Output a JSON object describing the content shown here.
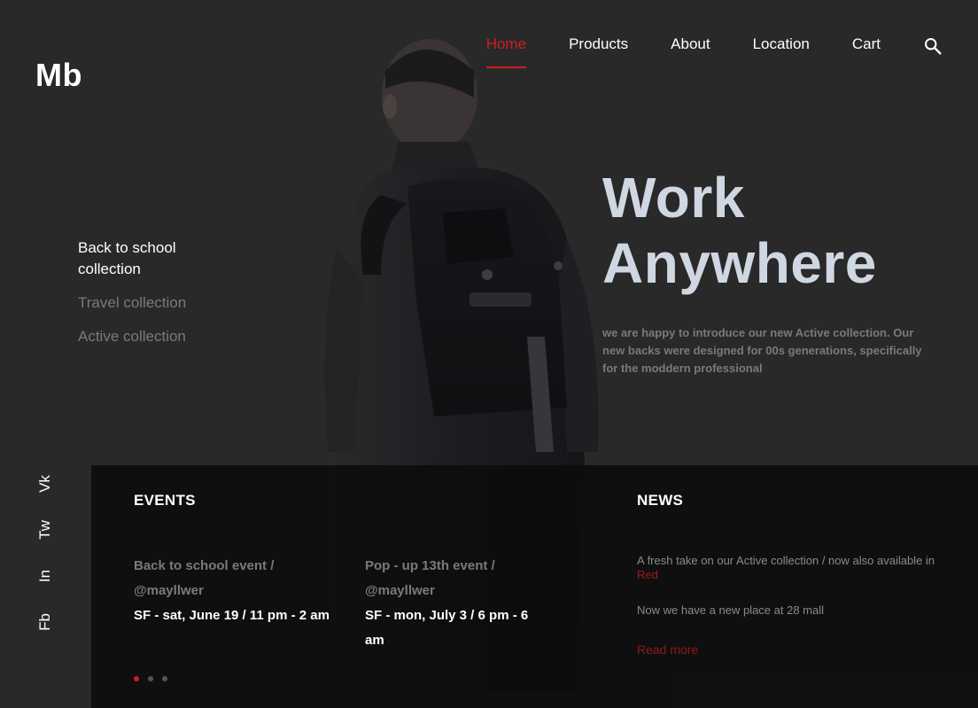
{
  "brand": {
    "logo": "Mb"
  },
  "nav": {
    "items": [
      {
        "label": "Home",
        "active": true
      },
      {
        "label": "Products",
        "active": false
      },
      {
        "label": "About",
        "active": false
      },
      {
        "label": "Location",
        "active": false
      },
      {
        "label": "Cart",
        "active": false
      }
    ],
    "search_icon": "search-icon"
  },
  "collections": [
    {
      "label": "Back to school collection",
      "active": true
    },
    {
      "label": "Travel collection",
      "active": false
    },
    {
      "label": "Active collection",
      "active": false
    }
  ],
  "hero": {
    "title_line1": "Work",
    "title_line2": "Anywhere",
    "description": "we are happy to introduce our new Active collection. Our new backs were designed for 00s generations, specifically for the moddern professional"
  },
  "socials": [
    "Vk",
    "Tw",
    "In",
    "Fb"
  ],
  "events": {
    "title": "EVENTS",
    "items": [
      {
        "name": "Back to school event / @mayllwer",
        "when": "SF - sat, June 19 / 11 pm - 2 am"
      },
      {
        "name": "Pop - up 13th event / @mayllwer",
        "when": "SF - mon, July 3 / 6 pm - 6 am"
      }
    ],
    "pager": {
      "count": 3,
      "active": 1
    }
  },
  "news": {
    "title": "NEWS",
    "items": [
      {
        "text": "A fresh take on our Active collection / now also available in",
        "highlight": "Red"
      },
      {
        "text": "Now we have a new place at 28 mall",
        "highlight": ""
      }
    ],
    "read_more": "Read more"
  },
  "colors": {
    "accent": "#cc1f1f",
    "background": "#292929",
    "panel": "#0c0c0c",
    "hero_title": "#cfd7e2",
    "muted_text": "#7a7a7a"
  }
}
